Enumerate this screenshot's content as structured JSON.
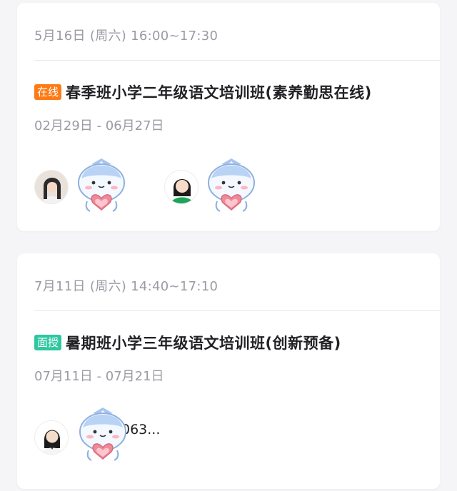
{
  "sessions": [
    {
      "time": "5月16日 (周六) 16:00~17:30",
      "tag": "在线",
      "tag_color": "#ff7a14",
      "title": "春季班小学二年级语文培训班(素养勤思在线)",
      "dates": "02月29日 - 06月27日"
    },
    {
      "time": "7月11日 (周六) 14:40~17:10",
      "tag": "面授",
      "tag_color": "#2ec7a0",
      "title": "暑期班小学三年级语文培训班(创新预备)",
      "dates": "07月11日 - 07月21日",
      "teacher_name_fragment": "063..."
    }
  ]
}
